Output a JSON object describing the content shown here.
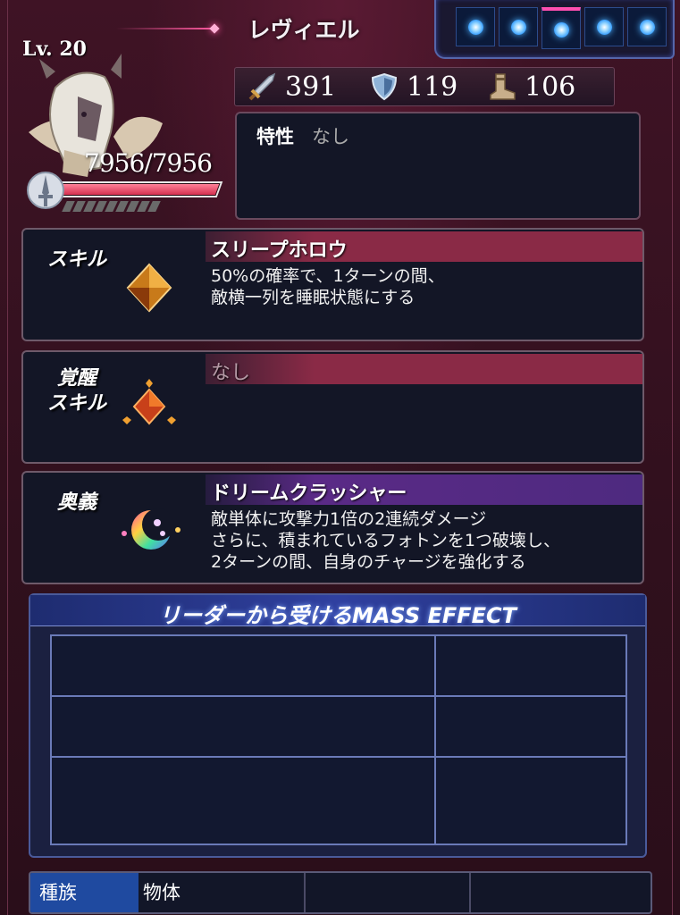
{
  "character": {
    "name": "レヴィエル",
    "level": "Lv. 20",
    "hp": "7956/7956",
    "hp_fraction": 1.0
  },
  "photons": {
    "count": 5,
    "active_index": 2
  },
  "stats": [
    {
      "icon": "sword-icon",
      "value": "391"
    },
    {
      "icon": "shield-icon",
      "value": "119"
    },
    {
      "icon": "boot-icon",
      "value": "106"
    }
  ],
  "trait": {
    "label": "特性",
    "value": "なし"
  },
  "skill": {
    "label": "スキル",
    "name": "スリープホロウ",
    "description": "50%の確率で、1ターンの間、\n敵横一列を睡眠状態にする"
  },
  "awakening": {
    "label": "覚醒\nスキル",
    "name": "なし"
  },
  "ougi": {
    "label": "奥義",
    "name": "ドリームクラッシャー",
    "description": "敵単体に攻撃力1倍の2連続ダメージ\nさらに、積まれているフォトンを1つ破壊し、\n2ターンの間、自身のチャージを強化する"
  },
  "mass_effect": {
    "title": "リーダーから受けるMASS EFFECT"
  },
  "race": {
    "label": "種族",
    "value": "物体"
  },
  "colors": {
    "hp_fill": "#d53050",
    "skill_header": "#8a2a46",
    "ougi_header": "#5a2a86",
    "race_label": "#1f4aa0"
  }
}
